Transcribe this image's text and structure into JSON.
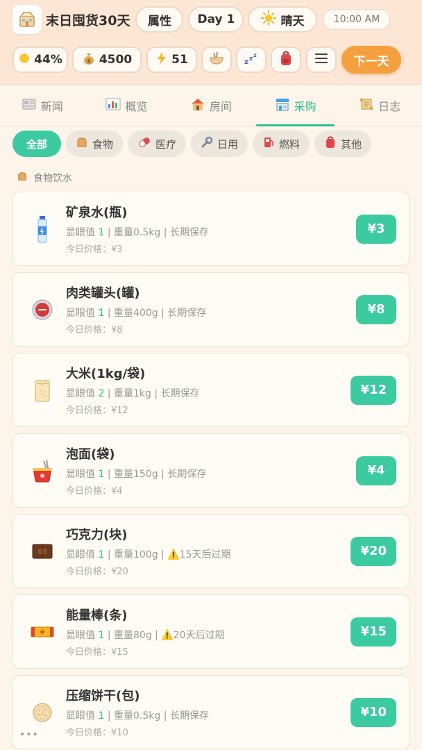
{
  "header": {
    "app_title": "末日囤货30天",
    "attr_button": "属性",
    "day": "Day 1",
    "weather": "晴天",
    "time": "10:00 AM",
    "stats": {
      "health": "44%",
      "money": "4500",
      "energy": "51"
    },
    "next_button": "下一天"
  },
  "tabs": [
    {
      "label": "新闻",
      "icon": "newspaper-icon"
    },
    {
      "label": "概览",
      "icon": "chart-icon"
    },
    {
      "label": "房间",
      "icon": "house-icon"
    },
    {
      "label": "采购",
      "icon": "shop-icon",
      "active": true
    },
    {
      "label": "日志",
      "icon": "scroll-icon"
    }
  ],
  "filters": [
    {
      "label": "全部",
      "active": true
    },
    {
      "label": "食物",
      "icon": "bread-icon"
    },
    {
      "label": "医疗",
      "icon": "pill-icon"
    },
    {
      "label": "日用",
      "icon": "wrench-icon"
    },
    {
      "label": "燃料",
      "icon": "fuel-icon"
    },
    {
      "label": "其他",
      "icon": "backpack-icon"
    }
  ],
  "section": {
    "title": "食物饮水"
  },
  "items": [
    {
      "name": "矿泉水(瓶)",
      "vis_label": "显眼值",
      "vis": "1",
      "weight": "重量0.5kg",
      "note": "长期保存",
      "today": "今日价格：¥3",
      "price": "¥3",
      "icon": "water-bottle-icon"
    },
    {
      "name": "肉类罐头(罐)",
      "vis_label": "显眼值",
      "vis": "1",
      "weight": "重量400g",
      "note": "长期保存",
      "today": "今日价格：¥8",
      "price": "¥8",
      "icon": "canned-meat-icon"
    },
    {
      "name": "大米(1kg/袋)",
      "vis_label": "显眼值",
      "vis": "2",
      "weight": "重量1kg",
      "note": "长期保存",
      "today": "今日价格：¥12",
      "price": "¥12",
      "icon": "rice-bag-icon"
    },
    {
      "name": "泡面(袋)",
      "vis_label": "显眼值",
      "vis": "1",
      "weight": "重量150g",
      "note": "长期保存",
      "today": "今日价格：¥4",
      "price": "¥4",
      "icon": "noodle-icon"
    },
    {
      "name": "巧克力(块)",
      "vis_label": "显眼值",
      "vis": "1",
      "weight": "重量100g",
      "note": "⚠️15天后过期",
      "today": "今日价格：¥20",
      "price": "¥20",
      "icon": "chocolate-icon"
    },
    {
      "name": "能量棒(条)",
      "vis_label": "显眼值",
      "vis": "1",
      "weight": "重量80g",
      "note": "⚠️20天后过期",
      "today": "今日价格：¥15",
      "price": "¥15",
      "icon": "energy-bar-icon"
    },
    {
      "name": "压缩饼干(包)",
      "vis_label": "显眼值",
      "vis": "1",
      "weight": "重量0.5kg",
      "note": "长期保存",
      "today": "今日价格：¥10",
      "price": "¥10",
      "icon": "biscuit-icon"
    }
  ],
  "colors": {
    "accent": "#3ccaa0",
    "orange": "#f5a03e",
    "background": "#fdf4ea"
  }
}
